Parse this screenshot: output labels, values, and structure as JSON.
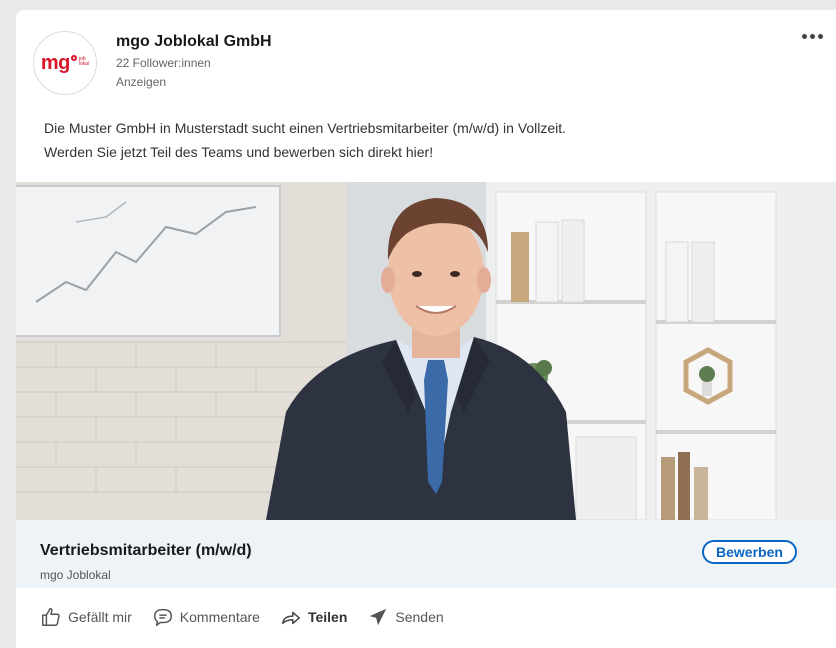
{
  "post": {
    "company_name": "mgo Joblokal GmbH",
    "followers": "22 Follower:innen",
    "sponsored_label": "Anzeigen",
    "logo": {
      "main": "mg",
      "small_line1": "job",
      "small_line2": "lokal"
    },
    "text_lines": [
      "Die Muster GmbH in Musterstadt sucht einen Vertriebsmitarbeiter (m/w/d) in Vollzeit.",
      "Werden Sie jetzt Teil des Teams und bewerben sich direkt hier!"
    ]
  },
  "job": {
    "title": "Vertriebsmitarbeiter (m/w/d)",
    "company": "mgo Joblokal",
    "apply_label": "Bewerben"
  },
  "actions": {
    "like": "Gefällt mir",
    "comment": "Kommentare",
    "share": "Teilen",
    "send": "Senden"
  },
  "colors": {
    "brand": "#d7162a",
    "accent": "#0a66c2",
    "job_strip_bg": "#eef3f8"
  }
}
